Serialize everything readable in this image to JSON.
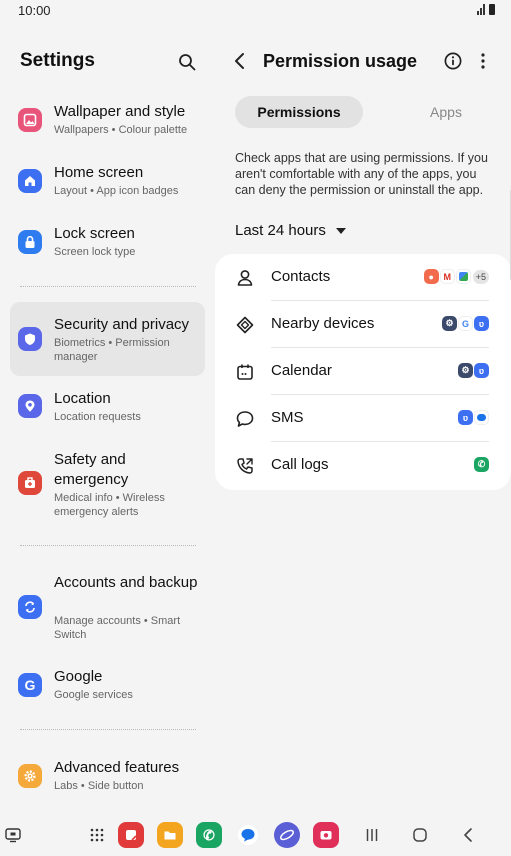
{
  "status": {
    "time": "10:00"
  },
  "settings": {
    "title": "Settings",
    "items": [
      {
        "label": "Wallpaper and style",
        "sub": "Wallpapers • Colour palette",
        "icon": "wallpaper-icon",
        "color": "#e8547a"
      },
      {
        "label": "Home screen",
        "sub": "Layout • App icon badges",
        "icon": "home-icon",
        "color": "#3d6ff2"
      },
      {
        "label": "Lock screen",
        "sub": "Screen lock type",
        "icon": "lock-icon",
        "color": "#2f7bf0"
      },
      {
        "label": "Security and privacy",
        "sub": "Biometrics • Permission manager",
        "icon": "shield-icon",
        "color": "#5a67e8"
      },
      {
        "label": "Location",
        "sub": "Location requests",
        "icon": "location-pin-icon",
        "color": "#5a67e8"
      },
      {
        "label": "Safety and emergency",
        "sub": "Medical info • Wireless emergency alerts",
        "icon": "emergency-icon",
        "color": "#e0473b"
      },
      {
        "label": "Accounts and backup",
        "sub": "Manage accounts • Smart Switch",
        "icon": "sync-icon",
        "color": "#3d6ff2"
      },
      {
        "label": "Google",
        "sub": "Google services",
        "icon": "google-icon",
        "color": "#3d6ff2"
      },
      {
        "label": "Advanced features",
        "sub": "Labs • Side button",
        "icon": "gear-icon",
        "color": "#f4a93a"
      }
    ]
  },
  "panel": {
    "title": "Permission usage",
    "tabs": [
      "Permissions",
      "Apps"
    ],
    "description": "Check apps that are using permissions. If you aren't comfortable with any of the apps, you can deny the permission or uninstall the app.",
    "period": "Last 24 hours",
    "permissions": [
      {
        "label": "Contacts",
        "icon": "contacts-icon",
        "more": "+5"
      },
      {
        "label": "Nearby devices",
        "icon": "nearby-devices-icon"
      },
      {
        "label": "Calendar",
        "icon": "calendar-icon"
      },
      {
        "label": "SMS",
        "icon": "sms-icon"
      },
      {
        "label": "Call logs",
        "icon": "call-logs-icon"
      }
    ]
  },
  "colors": {
    "accent": "#3d6ff2",
    "background": "#f4f4f4",
    "card": "#ffffff"
  }
}
